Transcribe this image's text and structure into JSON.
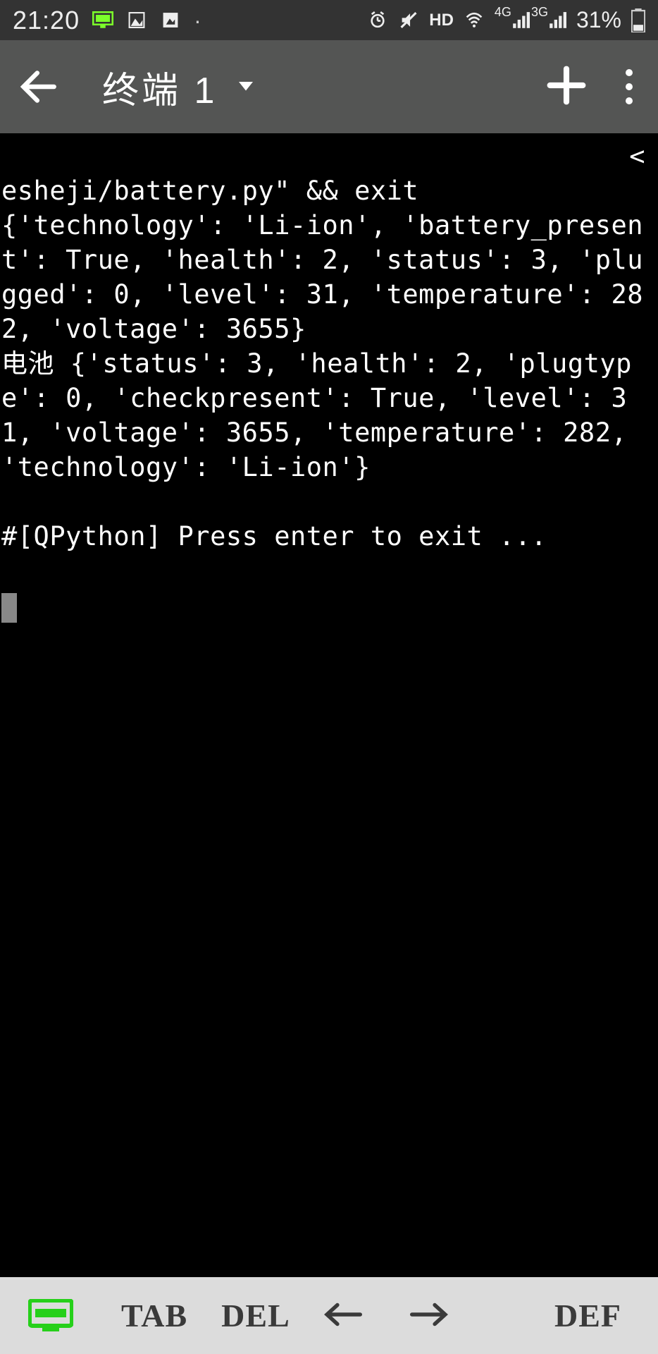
{
  "status": {
    "time": "21:20",
    "hd": "HD",
    "net1": "4G",
    "net2": "3G",
    "battery_pct": "31%"
  },
  "appbar": {
    "title": "终端 1"
  },
  "terminal": {
    "line1": "esheji/battery.py\" && exit",
    "corner": "<",
    "line2": "{'technology': 'Li-ion', 'battery_present': True, 'health': 2, 'status': 3, 'plugged': 0, 'level': 31, 'temperature': 282, 'voltage': 3655}",
    "line3": "电池 {'status': 3, 'health': 2, 'plugtype': 0, 'checkpresent': True, 'level': 31, 'voltage': 3655, 'temperature': 282, 'technology': 'Li-ion'}",
    "blank": "",
    "prompt": "#[QPython] Press enter to exit ..."
  },
  "bottom": {
    "tab": "TAB",
    "del": "DEL",
    "def": "DEF"
  }
}
